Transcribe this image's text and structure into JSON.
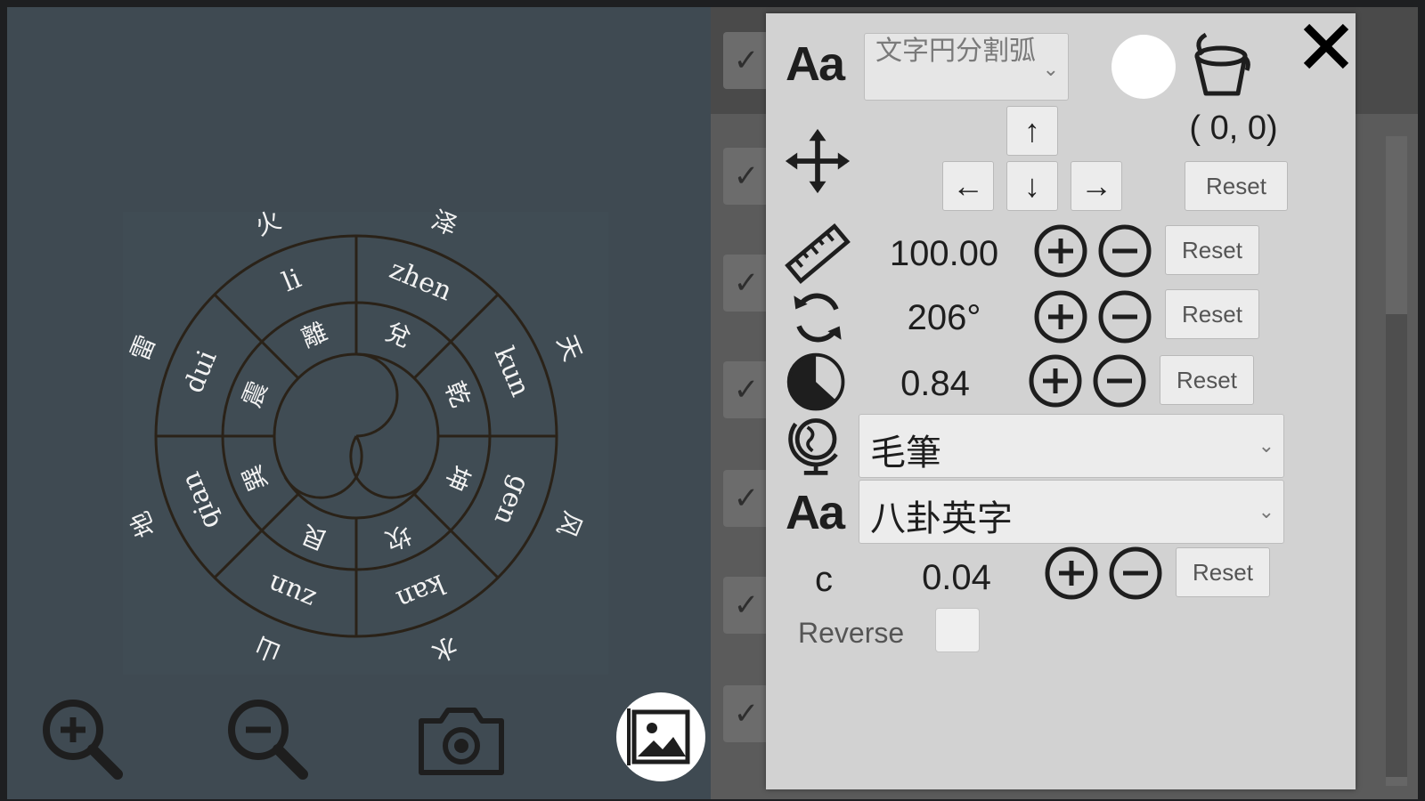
{
  "wheel": {
    "outer_labels": [
      "火",
      "泽",
      "天",
      "风",
      "水",
      "山",
      "地",
      "雷"
    ],
    "ring_labels": [
      "li",
      "zhen",
      "kun",
      "gen",
      "kan",
      "zun",
      "qian",
      "dui"
    ],
    "inner_labels": [
      "離",
      "兌",
      "乾",
      "坤",
      "坎",
      "艮",
      "巽",
      "震"
    ],
    "line_color": "#2a2218",
    "text_color": "#f2f2f2"
  },
  "toolbar": {
    "zoom_in_icon": "zoom-in-icon",
    "zoom_out_icon": "zoom-out-icon",
    "camera_icon": "camera-icon",
    "image_icon": "image-icon"
  },
  "panel": {
    "font_mode_select": "文字円分割弧",
    "text_color": "#ffffff",
    "coords": "( 0,  0)",
    "arrows": {
      "up": "↑",
      "left": "←",
      "down": "↓",
      "right": "→"
    },
    "reset_label": "Reset",
    "size_value": "100.00",
    "rotation_value": "206°",
    "ratio_value": "0.84",
    "style_select": "毛筆",
    "font_select": "八卦英字",
    "c_label": "c",
    "c_value": "0.04",
    "reverse_label": "Reverse",
    "reverse_checked": false,
    "aa_label": "Aa"
  },
  "background_list": {
    "check_glyph": "✓"
  }
}
